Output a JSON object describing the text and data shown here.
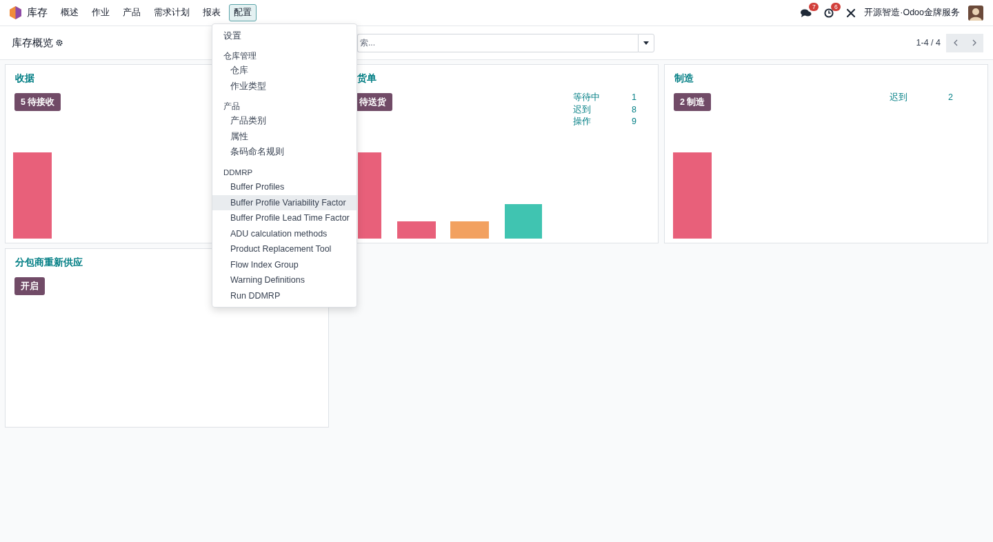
{
  "navbar": {
    "app_name": "库存",
    "menu": [
      {
        "label": "概述",
        "selected": false
      },
      {
        "label": "作业",
        "selected": false
      },
      {
        "label": "产品",
        "selected": false
      },
      {
        "label": "需求计划",
        "selected": false
      },
      {
        "label": "报表",
        "selected": false
      },
      {
        "label": "配置",
        "selected": true
      }
    ],
    "messages_badge": "7",
    "activities_badge": "6",
    "company": "开源智造·Odoo金牌服务"
  },
  "control_panel": {
    "breadcrumb": "库存概览",
    "search": {
      "placeholder": "索..."
    },
    "pager": "1-4 / 4"
  },
  "cards": [
    {
      "title": "收据",
      "button": "5 待接收"
    },
    {
      "title": "货单",
      "button": "待送货",
      "stats": [
        {
          "label": "等待中",
          "value": "1"
        },
        {
          "label": "迟到",
          "value": "8"
        },
        {
          "label": "操作",
          "value": "9"
        }
      ]
    },
    {
      "title": "制造",
      "button": "2 制造",
      "stats": [
        {
          "label": "迟到",
          "value": "2"
        }
      ]
    },
    {
      "title": "分包商重新供应",
      "button": "开启"
    }
  ],
  "config_menu": {
    "items": [
      {
        "kind": "item",
        "label": "设置",
        "highlighted": false
      },
      {
        "kind": "header",
        "label": "仓库管理"
      },
      {
        "kind": "subitem",
        "label": "仓库",
        "highlighted": false
      },
      {
        "kind": "subitem",
        "label": "作业类型",
        "highlighted": false
      },
      {
        "kind": "header",
        "label": "产品"
      },
      {
        "kind": "subitem",
        "label": "产品类别",
        "highlighted": false
      },
      {
        "kind": "subitem",
        "label": "属性",
        "highlighted": false
      },
      {
        "kind": "subitem",
        "label": "条码命名规则",
        "highlighted": false
      },
      {
        "kind": "header",
        "label": "DDMRP"
      },
      {
        "kind": "subitem",
        "label": "Buffer Profiles",
        "highlighted": false
      },
      {
        "kind": "subitem",
        "label": "Buffer Profile Variability Factor",
        "highlighted": true
      },
      {
        "kind": "subitem",
        "label": "Buffer Profile Lead Time Factor",
        "highlighted": false
      },
      {
        "kind": "subitem",
        "label": "ADU calculation methods",
        "highlighted": false
      },
      {
        "kind": "subitem",
        "label": "Product Replacement Tool",
        "highlighted": false
      },
      {
        "kind": "subitem",
        "label": "Flow Index Group",
        "highlighted": false
      },
      {
        "kind": "subitem",
        "label": "Warning Definitions",
        "highlighted": false
      },
      {
        "kind": "subitem",
        "label": "Run DDMRP",
        "highlighted": false
      }
    ]
  }
}
